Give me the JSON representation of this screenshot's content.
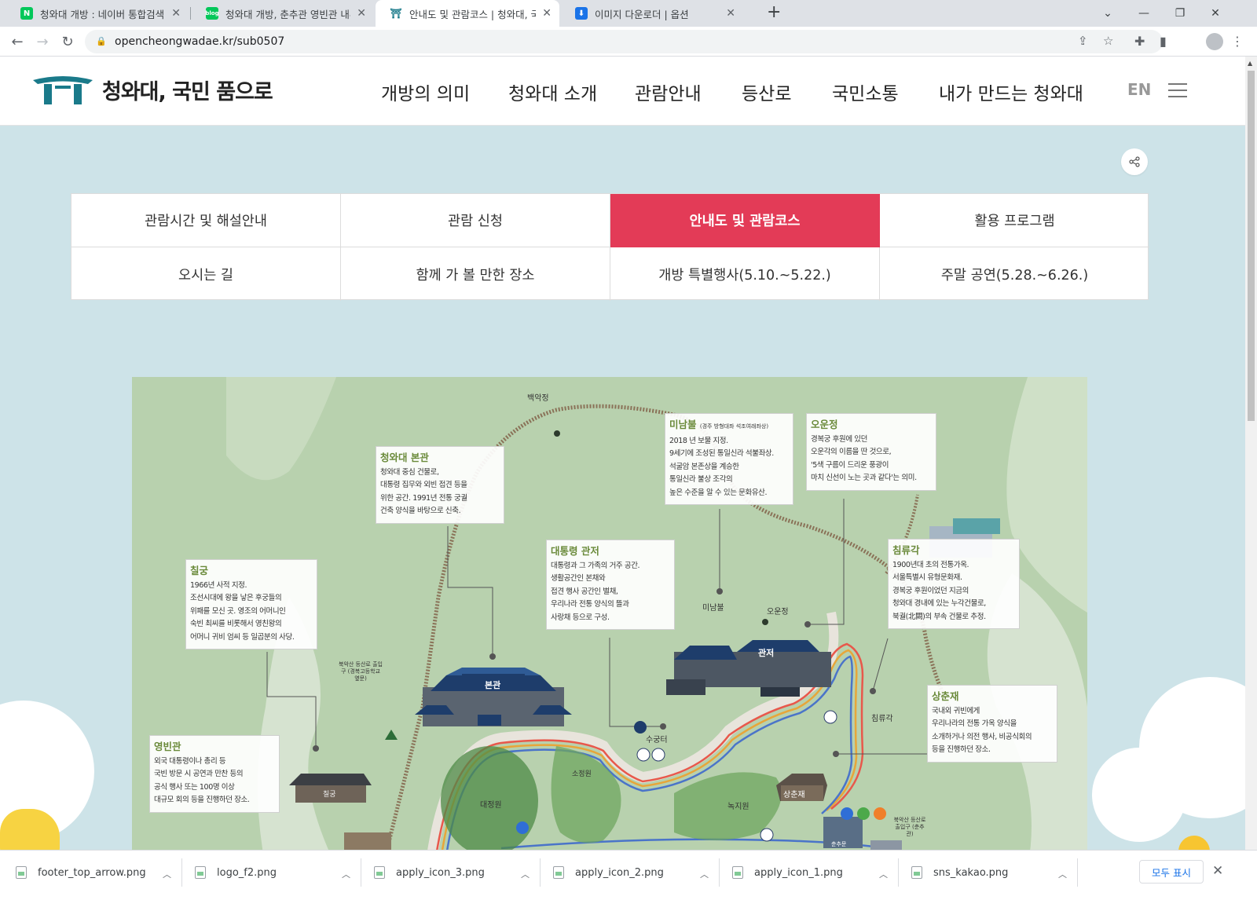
{
  "browser": {
    "tabs": [
      {
        "title": "청와대 개방 : 네이버 통합검색",
        "favicon": "naver-icon",
        "color": "#03c75a"
      },
      {
        "title": "청와대 개방, 춘추관 영빈관 내부",
        "favicon": "blog-icon",
        "color": "#03c75a"
      },
      {
        "title": "안내도 및 관람코스 | 청와대, 국",
        "favicon": "cheongwadae-icon",
        "color": "#1a7a8a"
      },
      {
        "title": "이미지 다운로더 | 옵션",
        "favicon": "download-icon",
        "color": "#1a73e8"
      }
    ],
    "url": "opencheongwadae.kr/sub0507"
  },
  "site": {
    "logo_text": "청와대, 국민 품으로",
    "nav": [
      "개방의 의미",
      "청와대 소개",
      "관람안내",
      "등산로",
      "국민소통",
      "내가 만드는 청와대"
    ],
    "lang": "EN"
  },
  "subtabs": [
    {
      "label": "관람시간 및 해설안내",
      "active": false
    },
    {
      "label": "관람 신청",
      "active": false
    },
    {
      "label": "안내도 및 관람코스",
      "active": true
    },
    {
      "label": "활용 프로그램",
      "active": false
    },
    {
      "label": "오시는 길",
      "active": false
    },
    {
      "label": "함께 가 볼 만한 장소",
      "active": false
    },
    {
      "label": "개방 특별행사(5.10.~5.22.)",
      "active": false
    },
    {
      "label": "주말 공연(5.28.~6.26.)",
      "active": false
    }
  ],
  "map": {
    "place_labels": {
      "baekak": "백악정",
      "mainhall": "본관",
      "residence": "관저",
      "minambul": "미남불",
      "oounjeong": "오운정",
      "chimnyugak": "침류각",
      "sugungteo": "수궁터",
      "sangchunjae": "상춘재",
      "daejeongwon": "대정원",
      "sojeongwon": "소정원",
      "noksiwon": "녹지원",
      "chilgung": "칠궁",
      "bukaksan_trail": "북악산 등산로 출입구 (경복고등학교 옆문)",
      "bukaksan_trail2": "북악산 등산로 출입구 (춘추관)",
      "gate": "춘추문"
    },
    "info_boxes": [
      {
        "title": "청와대 본관",
        "lines": [
          "청와대 중심 건물로,",
          "대통령 집무와 외빈 접견 등을",
          "위한 공간. 1991년 전통 궁궐",
          "건축 양식을 바탕으로 신축."
        ]
      },
      {
        "title": "미남불",
        "subtitle": "(경주 방형대좌 석조여래좌상)",
        "lines": [
          "2018 년 보물 지정.",
          "9세기에 조성된 통일신라 석불좌상.",
          "석굴암 본존상을 계승한",
          "통일신라 불상 조각의",
          "높은 수준을 알 수 있는 문화유산."
        ]
      },
      {
        "title": "오운정",
        "lines": [
          "경복궁 후원에 있던",
          "오운각의 이름을 딴 것으로,",
          "'5색 구름이 드리운 풍광이",
          "마치 신선이 노는 곳과 같다'는 의미."
        ]
      },
      {
        "title": "칠궁",
        "lines": [
          "1966년 사적 지정.",
          "조선시대에 왕을 낳은 후궁들의",
          "위패를 모신 곳. 영조의 어머니인",
          "숙빈 최씨를 비롯해서 영친왕의",
          "어머니 귀비 엄씨 등 일곱분의 사당."
        ]
      },
      {
        "title": "대통령 관저",
        "lines": [
          "대통령과 그 가족의 거주 공간.",
          "생활공간인 본채와",
          "접견 행사 공간인 별채,",
          "우리나라 전통 양식의 뜰과",
          "사랑채 등으로 구성."
        ]
      },
      {
        "title": "침류각",
        "lines": [
          "1900년대 초의 전통가옥.",
          "서울특별시 유형문화재.",
          "경복궁 후원이었던 지금의",
          "청와대 경내에 있는 누각건물로,",
          "북궐(北闕)의 부속 건물로 추정."
        ]
      },
      {
        "title": "영빈관",
        "lines": [
          "외국 대통령이나 총리 등",
          "국빈 방문 시 공연과 만찬 등의",
          "공식 행사 또는 100명 이상",
          "대규모 회의 등을 진행하던 장소."
        ]
      },
      {
        "title": "상춘재",
        "lines": [
          "국내외 귀빈에게",
          "우리나라의 전통 가옥 양식을",
          "소개하거나 의전 행사, 비공식회의",
          "등을 진행하던 장소."
        ]
      }
    ]
  },
  "downloads": {
    "files": [
      "footer_top_arrow.png",
      "logo_f2.png",
      "apply_icon_3.png",
      "apply_icon_2.png",
      "apply_icon_1.png",
      "sns_kakao.png"
    ],
    "show_all": "모두 표시"
  },
  "colors": {
    "accent": "#e33b57",
    "page_bg": "#cde3e8",
    "map_bg": "#b8d1ae",
    "info_title": "#6a8a3a"
  }
}
